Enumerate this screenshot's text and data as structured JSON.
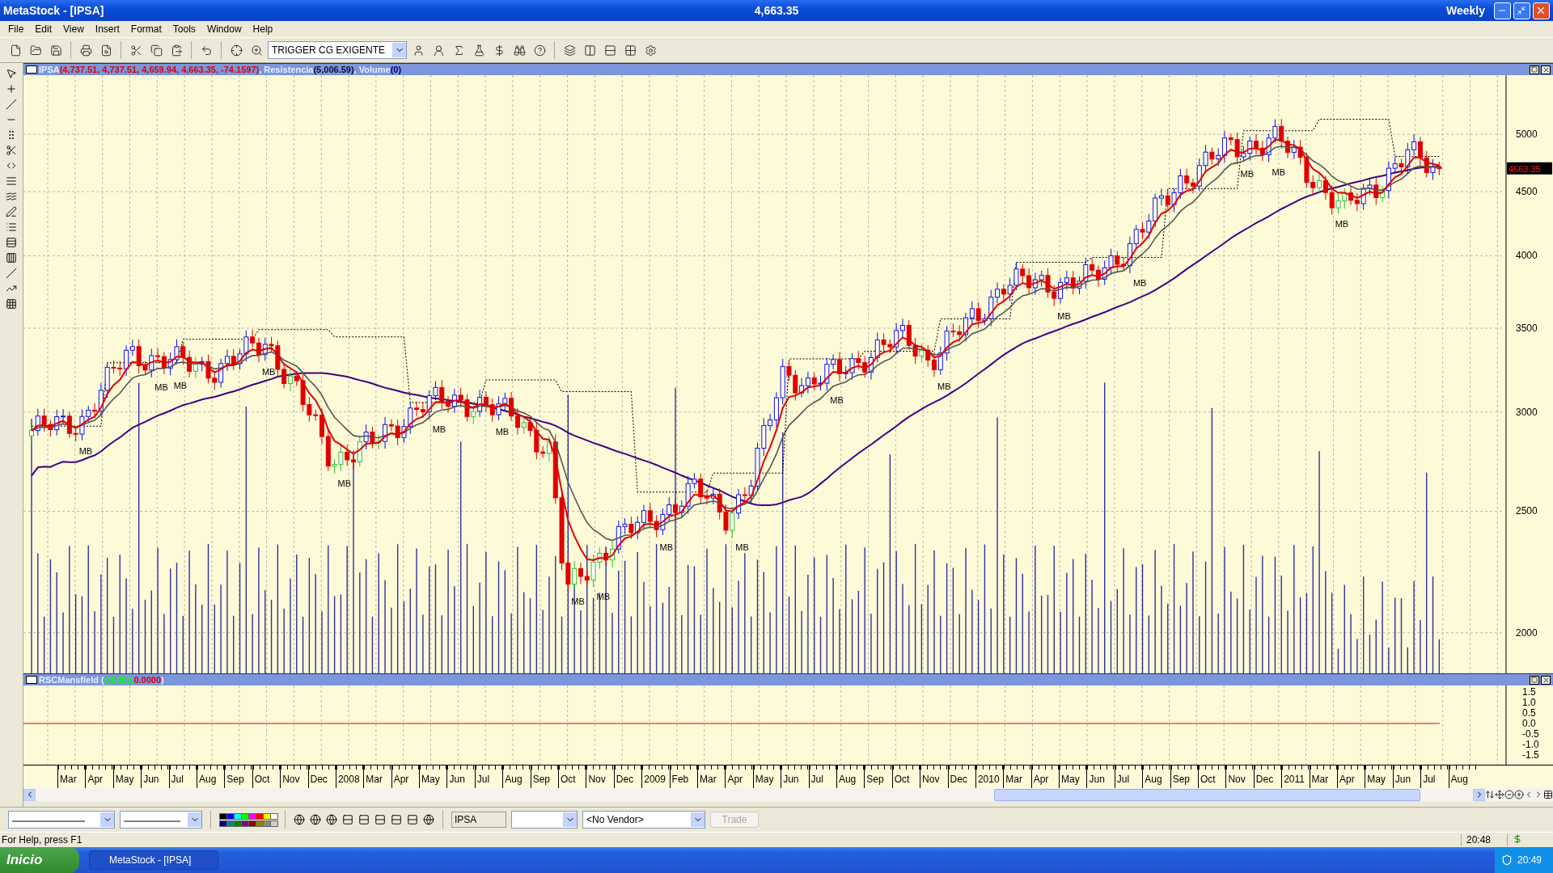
{
  "window": {
    "title": "MetaStock - [IPSA]",
    "price": "4,663.35",
    "period": "Weekly"
  },
  "menu": [
    "File",
    "Edit",
    "View",
    "Insert",
    "Format",
    "Tools",
    "Window",
    "Help"
  ],
  "toolbar": {
    "expert_dropdown": "TRIGGER CG EXIGENTE"
  },
  "price_pane": {
    "legend": [
      {
        "text": "IPSA",
        "color": "#e8f0ff"
      },
      {
        "text": "(4,737.51, 4,737.51, 4,659.94, 4,663.35, -74.1597)",
        "color": "#e00000"
      },
      {
        "text": ", Resistencia",
        "color": "#e8f0ff"
      },
      {
        "text": "(5,006.59)",
        "color": "#101030"
      },
      {
        "text": ", Volume",
        "color": "#e8f0ff"
      },
      {
        "text": "(0)",
        "color": "#000080"
      }
    ],
    "y_labels": [
      "5000",
      "4500",
      "4000",
      "3500",
      "3000",
      "2500",
      "2000"
    ],
    "last_price": "4663.35",
    "signals": [
      "MB",
      "MB",
      "MB",
      "MB",
      "MB",
      "MB",
      "MB",
      "MB",
      "MB",
      "MB",
      "MB",
      "MB",
      "MB",
      "MB",
      "MB",
      "MB",
      "MB",
      "MB"
    ]
  },
  "indicator_pane": {
    "legend": [
      {
        "text": "RSCMansfield (",
        "color": "#e8f0ff"
      },
      {
        "text": "0.0000,",
        "color": "#00ff00"
      },
      {
        "text": "0.0000",
        "color": "#e00000"
      },
      {
        "text": ")",
        "color": "#e8f0ff"
      }
    ],
    "y_labels": [
      "1.5",
      "1.0",
      "0.5",
      "0.0",
      "-0.5",
      "-1.0",
      "-1.5"
    ]
  },
  "date_axis": [
    "Mar",
    "Apr",
    "May",
    "Jun",
    "Jul",
    "Aug",
    "Sep",
    "Oct",
    "Nov",
    "Dec",
    "2008",
    "Mar",
    "Apr",
    "May",
    "Jun",
    "Jul",
    "Aug",
    "Sep",
    "Oct",
    "Nov",
    "Dec",
    "2009",
    "Feb",
    "Mar",
    "Apr",
    "May",
    "Jun",
    "Jul",
    "Aug",
    "Sep",
    "Oct",
    "Nov",
    "Dec",
    "2010",
    "Mar",
    "Apr",
    "May",
    "Jun",
    "Jul",
    "Aug",
    "Sep",
    "Oct",
    "Nov",
    "Dec",
    "2011",
    "Mar",
    "Apr",
    "May",
    "Jun",
    "Jul",
    "Aug"
  ],
  "bottom_toolbar": {
    "symbol": "IPSA",
    "vendor": "<No Vendor>",
    "trade_button": {
      "label": "Trade",
      "disabled": true
    }
  },
  "status_bar": {
    "help": "For Help, press F1",
    "time": "20:48"
  },
  "taskbar": {
    "start": "Inicio",
    "task": "MetaStock - [IPSA]",
    "clock": "20:49"
  }
}
